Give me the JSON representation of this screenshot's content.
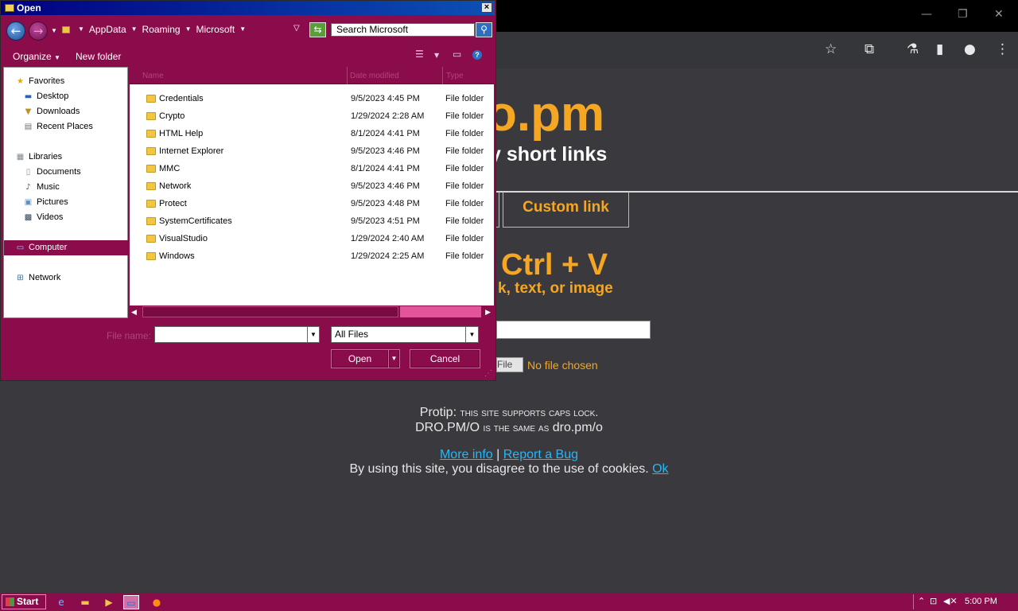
{
  "browser": {
    "brand_text": "o.pm",
    "tagline": "y short links",
    "custom_tab": "Custom link",
    "paste_heading": "Ctrl + V",
    "paste_sub": "k, text, or image",
    "file_button": "File",
    "no_file": "No file chosen",
    "protip_label": "Protip:",
    "protip_text": "this site supports caps lock.",
    "protip_line2_a": "DRO.PM/O",
    "protip_line2_b": "is the same as",
    "protip_line2_c": "dro.pm/o",
    "more_info": "More info",
    "link_sep": "|",
    "report_bug": "Report a Bug",
    "cookie_text": "By using this site, you disagree to the use of cookies.",
    "cookie_ok": "Ok"
  },
  "dialog": {
    "title": "Open",
    "breadcrumb": [
      "AppData",
      "Roaming",
      "Microsoft"
    ],
    "search_placeholder": "Search Microsoft",
    "organize": "Organize",
    "new_folder": "New folder",
    "columns": {
      "name": "Name",
      "date": "Date modified",
      "type": "Type"
    },
    "nav": {
      "favorites": "Favorites",
      "desktop": "Desktop",
      "downloads": "Downloads",
      "recent": "Recent Places",
      "libraries": "Libraries",
      "documents": "Documents",
      "music": "Music",
      "pictures": "Pictures",
      "videos": "Videos",
      "computer": "Computer",
      "network": "Network"
    },
    "files": [
      {
        "name": "Credentials",
        "date": "9/5/2023 4:45 PM",
        "type": "File folder"
      },
      {
        "name": "Crypto",
        "date": "1/29/2024 2:28 AM",
        "type": "File folder"
      },
      {
        "name": "HTML Help",
        "date": "8/1/2024 4:41 PM",
        "type": "File folder"
      },
      {
        "name": "Internet Explorer",
        "date": "9/5/2023 4:46 PM",
        "type": "File folder"
      },
      {
        "name": "MMC",
        "date": "8/1/2024 4:41 PM",
        "type": "File folder"
      },
      {
        "name": "Network",
        "date": "9/5/2023 4:46 PM",
        "type": "File folder"
      },
      {
        "name": "Protect",
        "date": "9/5/2023 4:48 PM",
        "type": "File folder"
      },
      {
        "name": "SystemCertificates",
        "date": "9/5/2023 4:51 PM",
        "type": "File folder"
      },
      {
        "name": "VisualStudio",
        "date": "1/29/2024 2:40 AM",
        "type": "File folder"
      },
      {
        "name": "Windows",
        "date": "1/29/2024 2:25 AM",
        "type": "File folder"
      }
    ],
    "file_name_label": "File name:",
    "file_name_value": "",
    "file_type_value": "All Files",
    "open_button": "Open",
    "cancel_button": "Cancel"
  },
  "taskbar": {
    "start": "Start",
    "clock": "5:00 PM"
  },
  "colors": {
    "dialog_bg": "#8b0c4b",
    "accent_orange": "#f5a623",
    "link_blue": "#29b6f6"
  }
}
